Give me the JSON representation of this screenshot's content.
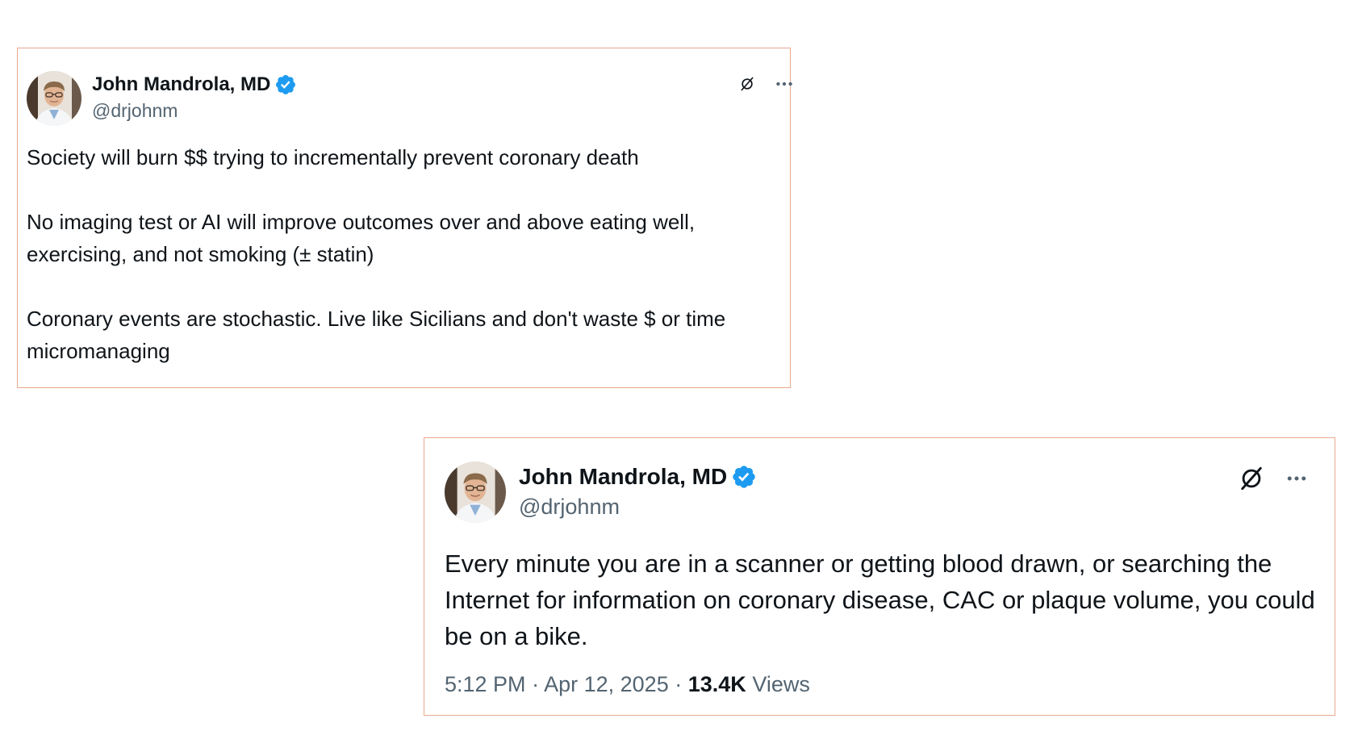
{
  "tweets": [
    {
      "author": {
        "display_name": "John Mandrola, MD",
        "handle": "@drjohnm",
        "verified": true,
        "verified_icon": "verified-badge-icon",
        "verified_color": "#1d9bf0"
      },
      "paragraphs": [
        "Society will burn $$ trying to incrementally prevent coronary death",
        "No imaging test or AI will improve outcomes over and above eating well, exercising, and not smoking (± statin)",
        "Coronary events are stochastic. Live like Sicilians and don't waste $ or time micromanaging"
      ],
      "actions": {
        "grok_icon": "grok-icon",
        "more_icon": "more-options-icon"
      }
    },
    {
      "author": {
        "display_name": "John Mandrola, MD",
        "handle": "@drjohnm",
        "verified": true,
        "verified_icon": "verified-badge-icon",
        "verified_color": "#1d9bf0"
      },
      "paragraphs": [
        "Every minute you are in a scanner or getting blood drawn, or searching the Internet for information on coronary disease, CAC or plaque volume, you could be on a bike."
      ],
      "meta": {
        "time": "5:12 PM",
        "separator": "·",
        "date": "Apr 12, 2025",
        "views_count": "13.4K",
        "views_label": "Views"
      },
      "actions": {
        "grok_icon": "grok-icon",
        "more_icon": "more-options-icon"
      }
    }
  ],
  "colors": {
    "card_border": "#e8a98f",
    "text_primary": "#0f1419",
    "text_secondary": "#536471",
    "verified_blue": "#1d9bf0"
  }
}
